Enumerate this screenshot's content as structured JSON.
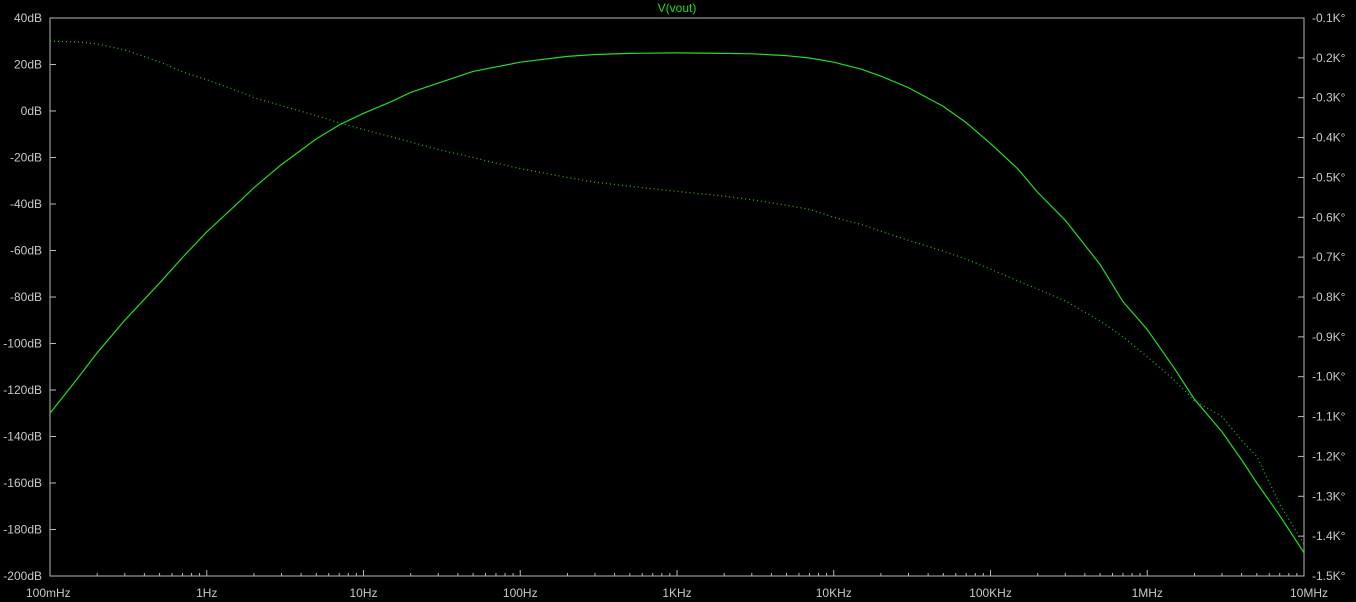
{
  "chart_data": {
    "type": "line",
    "title": "V(vout)",
    "xscale": "log",
    "xlim": [
      0.1,
      10000000
    ],
    "ylim_left": [
      -200,
      40
    ],
    "ylim_right": [
      -1500,
      -100
    ],
    "grid": false,
    "x_ticks": [
      {
        "value": 0.1,
        "label": "100mHz"
      },
      {
        "value": 1,
        "label": "1Hz"
      },
      {
        "value": 10,
        "label": "10Hz"
      },
      {
        "value": 100,
        "label": "100Hz"
      },
      {
        "value": 1000,
        "label": "1KHz"
      },
      {
        "value": 10000,
        "label": "10KHz"
      },
      {
        "value": 100000,
        "label": "100KHz"
      },
      {
        "value": 1000000,
        "label": "1MHz"
      },
      {
        "value": 10000000,
        "label": "10MHz"
      }
    ],
    "y_ticks_left": [
      {
        "value": 40,
        "label": "40dB"
      },
      {
        "value": 20,
        "label": "20dB"
      },
      {
        "value": 0,
        "label": "0dB"
      },
      {
        "value": -20,
        "label": "-20dB"
      },
      {
        "value": -40,
        "label": "-40dB"
      },
      {
        "value": -60,
        "label": "-60dB"
      },
      {
        "value": -80,
        "label": "-80dB"
      },
      {
        "value": -100,
        "label": "-100dB"
      },
      {
        "value": -120,
        "label": "-120dB"
      },
      {
        "value": -140,
        "label": "-140dB"
      },
      {
        "value": -160,
        "label": "-160dB"
      },
      {
        "value": -180,
        "label": "-180dB"
      },
      {
        "value": -200,
        "label": "-200dB"
      }
    ],
    "y_ticks_right": [
      {
        "value": -100,
        "label": "-0.1K°"
      },
      {
        "value": -200,
        "label": "-0.2K°"
      },
      {
        "value": -300,
        "label": "-0.3K°"
      },
      {
        "value": -400,
        "label": "-0.4K°"
      },
      {
        "value": -500,
        "label": "-0.5K°"
      },
      {
        "value": -600,
        "label": "-0.6K°"
      },
      {
        "value": -700,
        "label": "-0.7K°"
      },
      {
        "value": -800,
        "label": "-0.8K°"
      },
      {
        "value": -900,
        "label": "-0.9K°"
      },
      {
        "value": -1000,
        "label": "-1.0K°"
      },
      {
        "value": -1100,
        "label": "-1.1K°"
      },
      {
        "value": -1200,
        "label": "-1.2K°"
      },
      {
        "value": -1300,
        "label": "-1.3K°"
      },
      {
        "value": -1400,
        "label": "-1.4K°"
      },
      {
        "value": -1500,
        "label": "-1.5K°"
      }
    ],
    "series": [
      {
        "axis": "left",
        "style": "solid",
        "color": "#22dd22",
        "points": [
          [
            0.1,
            -130
          ],
          [
            0.15,
            -115
          ],
          [
            0.2,
            -104
          ],
          [
            0.3,
            -90
          ],
          [
            0.5,
            -74
          ],
          [
            0.7,
            -63
          ],
          [
            1,
            -52
          ],
          [
            1.5,
            -41
          ],
          [
            2,
            -33
          ],
          [
            3,
            -23
          ],
          [
            5,
            -12
          ],
          [
            7,
            -6
          ],
          [
            10,
            -1
          ],
          [
            15,
            4
          ],
          [
            20,
            8
          ],
          [
            30,
            12
          ],
          [
            50,
            17
          ],
          [
            100,
            21
          ],
          [
            200,
            23.5
          ],
          [
            300,
            24.3
          ],
          [
            500,
            24.8
          ],
          [
            1000,
            25
          ],
          [
            2000,
            24.8
          ],
          [
            3000,
            24.6
          ],
          [
            5000,
            23.8
          ],
          [
            7000,
            22.8
          ],
          [
            10000,
            21
          ],
          [
            15000,
            18
          ],
          [
            20000,
            15
          ],
          [
            30000,
            10
          ],
          [
            50000,
            2
          ],
          [
            70000,
            -5
          ],
          [
            100000,
            -14
          ],
          [
            150000,
            -25
          ],
          [
            200000,
            -35
          ],
          [
            300000,
            -47
          ],
          [
            500000,
            -66
          ],
          [
            700000,
            -82
          ],
          [
            1000000,
            -94
          ],
          [
            1500000,
            -111
          ],
          [
            2000000,
            -124
          ],
          [
            3000000,
            -138
          ],
          [
            4000000,
            -150
          ],
          [
            5000000,
            -160
          ],
          [
            7000000,
            -174
          ],
          [
            10000000,
            -190
          ]
        ]
      },
      {
        "axis": "right",
        "style": "dotted",
        "color": "#22dd22",
        "points": [
          [
            0.1,
            -158
          ],
          [
            0.15,
            -160
          ],
          [
            0.2,
            -165
          ],
          [
            0.3,
            -180
          ],
          [
            0.5,
            -210
          ],
          [
            0.7,
            -235
          ],
          [
            1,
            -255
          ],
          [
            1.5,
            -280
          ],
          [
            2,
            -300
          ],
          [
            3,
            -320
          ],
          [
            5,
            -345
          ],
          [
            7,
            -363
          ],
          [
            10,
            -380
          ],
          [
            15,
            -398
          ],
          [
            20,
            -411
          ],
          [
            30,
            -430
          ],
          [
            50,
            -450
          ],
          [
            70,
            -464
          ],
          [
            100,
            -478
          ],
          [
            200,
            -500
          ],
          [
            300,
            -512
          ],
          [
            500,
            -522
          ],
          [
            1000,
            -535
          ],
          [
            2000,
            -547
          ],
          [
            3000,
            -556
          ],
          [
            5000,
            -570
          ],
          [
            7000,
            -580
          ],
          [
            10000,
            -600
          ],
          [
            15000,
            -618
          ],
          [
            20000,
            -635
          ],
          [
            30000,
            -658
          ],
          [
            50000,
            -685
          ],
          [
            70000,
            -705
          ],
          [
            100000,
            -730
          ],
          [
            150000,
            -760
          ],
          [
            200000,
            -780
          ],
          [
            300000,
            -810
          ],
          [
            500000,
            -860
          ],
          [
            700000,
            -900
          ],
          [
            1000000,
            -950
          ],
          [
            1500000,
            -1010
          ],
          [
            2000000,
            -1060
          ],
          [
            3000000,
            -1100
          ],
          [
            4000000,
            -1160
          ],
          [
            5000000,
            -1200
          ],
          [
            7000000,
            -1320
          ],
          [
            10000000,
            -1420
          ]
        ]
      }
    ]
  }
}
